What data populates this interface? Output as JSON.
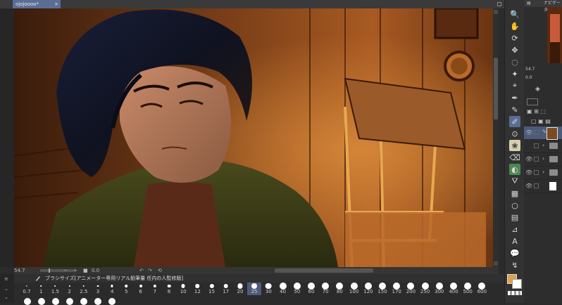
{
  "document": {
    "tab_title": "ojojoooo*",
    "close_glyph": "×"
  },
  "navigator": {
    "title": "ナビゲーター"
  },
  "status": {
    "zoom": "54.7",
    "angle": "0.0",
    "nav_zoom": "54.7",
    "nav_angle": "0.0"
  },
  "brush_panel": {
    "title": "ブラシサイズ[アニメーター専用リアル鉛筆量 任内の人監修版]",
    "sizes": [
      "0.7",
      "1",
      "1.5",
      "2",
      "2.5",
      "3",
      "4",
      "5",
      "6",
      "7",
      "8",
      "10",
      "12",
      "15",
      "17",
      "20",
      "25",
      "30",
      "40",
      "50",
      "60",
      "70",
      "80",
      "100",
      "120",
      "150",
      "170",
      "200",
      "250",
      "300",
      "400",
      "500",
      "600"
    ],
    "selected_size": "25"
  },
  "colors": {
    "main": "#e0a24a",
    "sub": "#ffffff",
    "accent": "#5a6e93"
  },
  "tools": [
    {
      "name": "zoom-icon"
    },
    {
      "name": "hand-icon"
    },
    {
      "name": "rotate-icon"
    },
    {
      "name": "move-icon"
    },
    {
      "name": "lasso-icon"
    },
    {
      "name": "wand-icon"
    },
    {
      "name": "eyedropper-icon"
    },
    {
      "name": "pen-icon"
    },
    {
      "name": "pencil-icon"
    },
    {
      "name": "brush-icon"
    },
    {
      "name": "airbrush-icon"
    },
    {
      "name": "decoration-icon"
    },
    {
      "name": "eraser-icon"
    },
    {
      "name": "blend-icon"
    },
    {
      "name": "fill-icon"
    },
    {
      "name": "gradient-icon"
    },
    {
      "name": "figure-icon"
    },
    {
      "name": "frame-icon"
    },
    {
      "name": "ruler-icon"
    },
    {
      "name": "text-icon"
    },
    {
      "name": "balloon-icon"
    },
    {
      "name": "correct-line-icon"
    }
  ]
}
